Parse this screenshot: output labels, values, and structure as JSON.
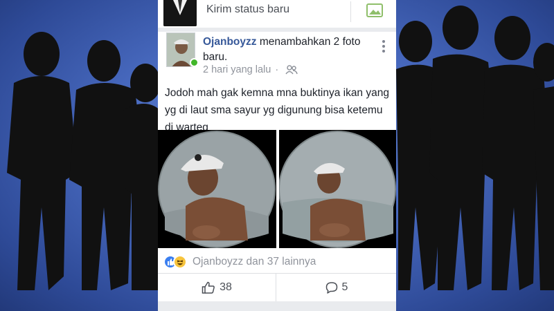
{
  "composer": {
    "placeholder": "Kirim status baru",
    "avatar_icon": "avatar-icon",
    "photo_icon": "photo-icon"
  },
  "post": {
    "author": "Ojanboyzz",
    "action": " menambahkan 2 foto baru.",
    "time": "2 hari yang lalu",
    "separator": "·",
    "audience_icon": "friends-icon",
    "menu_icon": "more-vertical-icon",
    "body": "Jodoh mah gak kemna mna buktinya ikan yang yg di laut sma sayur yg digunung bisa ketemu di warteg",
    "photos": [
      "photo-1",
      "photo-2"
    ]
  },
  "reactions": {
    "summary": "Ojanboyzz dan 37 lainnya",
    "icons": [
      "like-reaction-icon",
      "haha-reaction-icon"
    ]
  },
  "actions": {
    "like_count": "38",
    "comment_count": "5"
  },
  "colors": {
    "link": "#365899",
    "online": "#42b72a",
    "background": "#4a6cc2"
  }
}
